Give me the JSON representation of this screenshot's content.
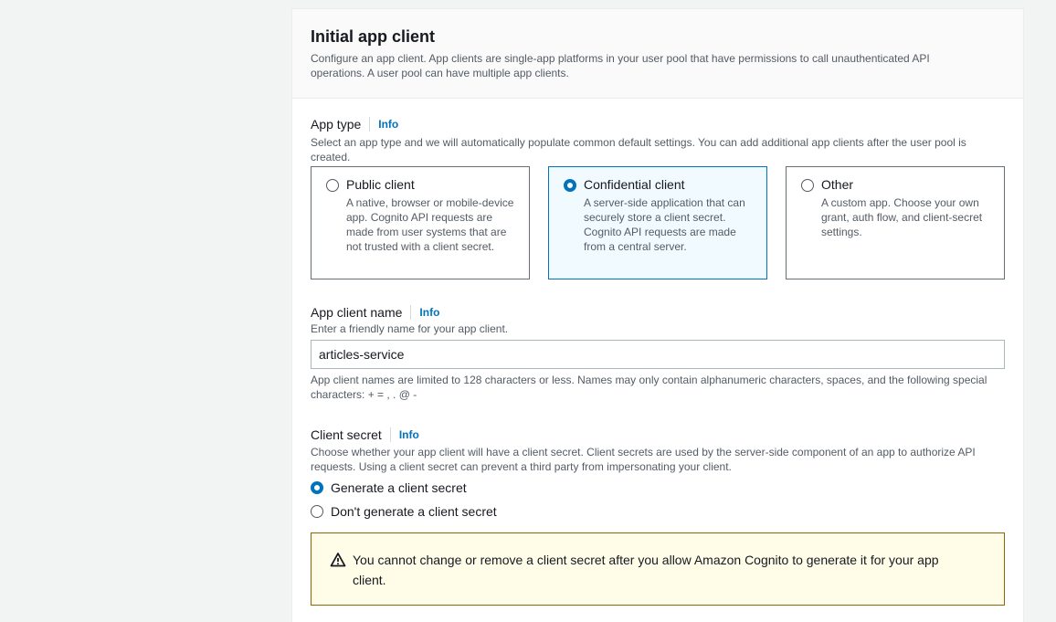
{
  "section": {
    "title": "Initial app client",
    "description": "Configure an app client. App clients are single-app platforms in your user pool that have permissions to call unauthenticated API operations. A user pool can have multiple app clients."
  },
  "app_type": {
    "label": "App type",
    "info": "Info",
    "description": "Select an app type and we will automatically populate common default settings. You can add additional app clients after the user pool is created.",
    "options": [
      {
        "title": "Public client",
        "description": "A native, browser or mobile-device app. Cognito API requests are made from user systems that are not trusted with a client secret.",
        "selected": false
      },
      {
        "title": "Confidential client",
        "description": "A server-side application that can securely store a client secret. Cognito API requests are made from a central server.",
        "selected": true
      },
      {
        "title": "Other",
        "description": "A custom app. Choose your own grant, auth flow, and client-secret settings.",
        "selected": false
      }
    ]
  },
  "app_client_name": {
    "label": "App client name",
    "info": "Info",
    "description": "Enter a friendly name for your app client.",
    "value": "articles-service",
    "constraint": "App client names are limited to 128 characters or less. Names may only contain alphanumeric characters, spaces, and the following special characters: + = , . @ -"
  },
  "client_secret": {
    "label": "Client secret",
    "info": "Info",
    "description": "Choose whether your app client will have a client secret. Client secrets are used by the server-side component of an app to authorize API requests. Using a client secret can prevent a third party from impersonating your client.",
    "options": [
      {
        "label": "Generate a client secret",
        "selected": true
      },
      {
        "label": "Don't generate a client secret",
        "selected": false
      }
    ],
    "warning": "You cannot change or remove a client secret after you allow Amazon Cognito to generate it for your app client."
  },
  "colors": {
    "accent": "#0073bb",
    "warning_border": "#8d6605",
    "warning_bg": "#fffce8"
  },
  "icons": {
    "warning": "warning-triangle-icon"
  }
}
